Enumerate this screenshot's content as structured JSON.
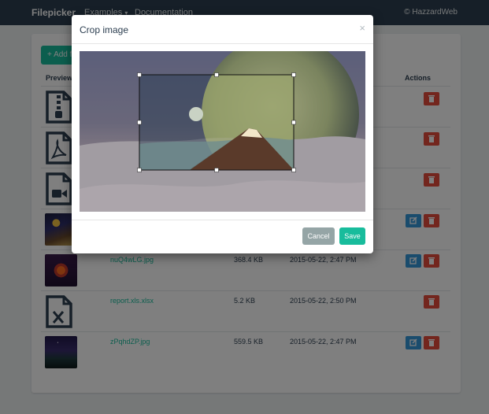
{
  "navbar": {
    "brand": "Filepicker",
    "examples": "Examples",
    "docs": "Documentation",
    "copyright": "© HazzardWeb"
  },
  "toolbar": {
    "add_label": "+ Add files"
  },
  "table": {
    "headers": {
      "preview": "Preview",
      "actions": "Actions"
    },
    "rows": [
      {
        "preview": "zip-file-icon",
        "name": "",
        "size": "",
        "date": ""
      },
      {
        "preview": "pdf-file-icon",
        "name": "",
        "size": "",
        "date": ""
      },
      {
        "preview": "video-file-icon",
        "name": "",
        "size": "",
        "date": ""
      },
      {
        "preview": "planet-thumbnail",
        "name": "",
        "size": "",
        "date": ""
      },
      {
        "preview": "phoenix-thumbnail",
        "name": "nuQ4wLG.jpg",
        "size": "368.4 KB",
        "date": "2015-05-22, 2:47 PM"
      },
      {
        "preview": "excel-file-icon",
        "name": "report.xls.xlsx",
        "size": "5.2 KB",
        "date": "2015-05-22, 2:50 PM"
      },
      {
        "preview": "forest-thumbnail",
        "name": "zPqhdZP.jpg",
        "size": "559.5 KB",
        "date": "2015-05-22, 2:47 PM"
      }
    ]
  },
  "modal": {
    "title": "Crop image",
    "close": "×",
    "cancel": "Cancel",
    "save": "Save"
  },
  "colors": {
    "navbar": "#2c3e50",
    "accent": "#18bc9c",
    "danger": "#e74c3c",
    "info": "#3498db",
    "muted": "#95a5a6"
  }
}
